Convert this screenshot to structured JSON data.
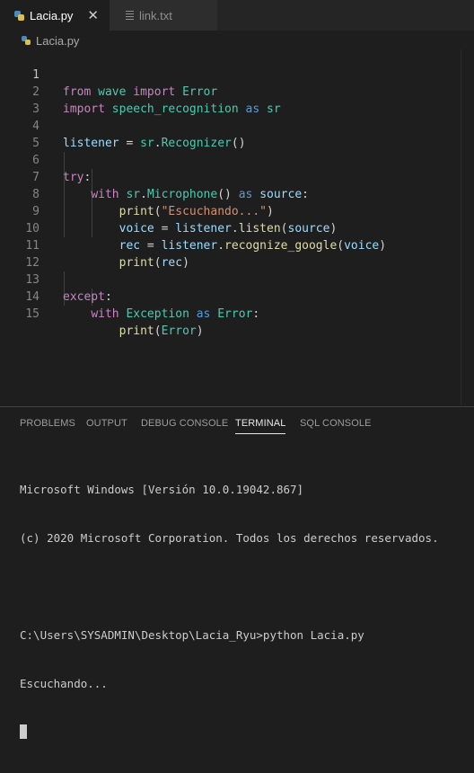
{
  "tabs": [
    {
      "label": "Lacia.py",
      "active": true,
      "icon": "python-file-icon"
    },
    {
      "label": "link.txt",
      "active": false,
      "icon": "text-file-icon"
    }
  ],
  "close_glyph": "✕",
  "breadcrumb": {
    "file": "Lacia.py"
  },
  "editor": {
    "current_line": 1,
    "lines": [
      {
        "n": "1"
      },
      {
        "n": "2"
      },
      {
        "n": "3"
      },
      {
        "n": "4"
      },
      {
        "n": "5"
      },
      {
        "n": "6"
      },
      {
        "n": "7"
      },
      {
        "n": "8"
      },
      {
        "n": "9"
      },
      {
        "n": "10"
      },
      {
        "n": "11"
      },
      {
        "n": "12"
      },
      {
        "n": "13"
      },
      {
        "n": "14"
      },
      {
        "n": "15"
      }
    ],
    "tokens": {
      "l1": [
        "from",
        "wave",
        "import",
        "Error"
      ],
      "l2": [
        "import",
        "speech_recognition",
        "as",
        "sr"
      ],
      "l4": [
        "listener",
        " = ",
        "sr",
        ".",
        "Recognizer",
        "()"
      ],
      "l6": [
        "try",
        ":"
      ],
      "l7": [
        "with",
        "sr",
        ".",
        "Microphone",
        "() ",
        "as",
        "source",
        ":"
      ],
      "l8": [
        "print",
        "(",
        "\"Escuchando...\"",
        ")"
      ],
      "l9": [
        "voice",
        " = ",
        "listener",
        ".",
        "listen",
        "(",
        "source",
        ")"
      ],
      "l10": [
        "rec",
        " = ",
        "listener",
        ".",
        "recognize_google",
        "(",
        "voice",
        ")"
      ],
      "l11": [
        "print",
        "(",
        "rec",
        ")"
      ],
      "l13": [
        "except",
        ":"
      ],
      "l14": [
        "with",
        "Exception",
        "as",
        "Error",
        ":"
      ],
      "l15": [
        "print",
        "(",
        "Error",
        ")"
      ]
    }
  },
  "panel": {
    "tabs": [
      "PROBLEMS",
      "OUTPUT",
      "DEBUG CONSOLE",
      "TERMINAL",
      "SQL CONSOLE"
    ],
    "active_tab": "TERMINAL"
  },
  "terminal": {
    "lines": [
      "Microsoft Windows [Versión 10.0.19042.867]",
      "(c) 2020 Microsoft Corporation. Todos los derechos reservados.",
      "",
      "C:\\Users\\SYSADMIN\\Desktop\\Lacia_Ryu>python Lacia.py",
      "Escuchando..."
    ]
  },
  "colors": {
    "keyword": "#c586c0",
    "builtin_keyword": "#569cd6",
    "module": "#4ec9b0",
    "function": "#dcdcaa",
    "variable": "#9cdcfe",
    "string": "#ce9178",
    "background": "#1e1e1e",
    "tabbar": "#252526"
  }
}
